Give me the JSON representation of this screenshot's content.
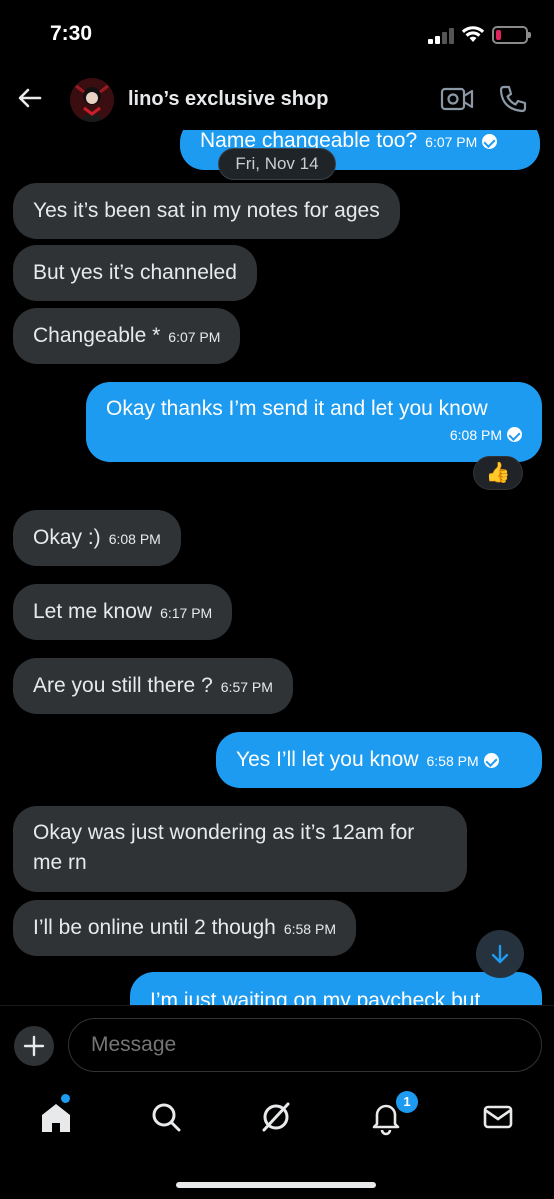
{
  "status_bar": {
    "time": "7:30"
  },
  "header": {
    "title": "lino’s exclusive shop"
  },
  "chat": {
    "date_divider": "Fri, Nov 14",
    "messages": [
      {
        "dir": "out",
        "text": "Name changeable too?",
        "time": "6:07 PM"
      },
      {
        "dir": "in",
        "text": "Yes it’s been sat in my notes for ages",
        "time": ""
      },
      {
        "dir": "in",
        "text": "But yes it’s channeled",
        "time": ""
      },
      {
        "dir": "in",
        "text": "Changeable *",
        "time": "6:07 PM"
      },
      {
        "dir": "out",
        "text": "Okay thanks I’m send it and let you know",
        "time": "6:08 PM"
      },
      {
        "dir": "in",
        "text": "Okay :)",
        "time": "6:08 PM"
      },
      {
        "dir": "in",
        "text": "Let me know",
        "time": "6:17 PM"
      },
      {
        "dir": "in",
        "text": "Are you still there ?",
        "time": "6:57 PM"
      },
      {
        "dir": "out",
        "text": "Yes I’ll let you know",
        "time": "6:58 PM"
      },
      {
        "dir": "in",
        "text": "Okay was just wondering as it’s 12am for me rn",
        "time": ""
      },
      {
        "dir": "in",
        "text": "I’ll be online until 2 though",
        "time": "6:58 PM"
      },
      {
        "dir": "out",
        "text": "I’m just waiting on my paycheck but",
        "time": ""
      }
    ],
    "reaction": "👍"
  },
  "composer": {
    "placeholder": "Message"
  },
  "tabbar": {
    "notification_count": "1"
  },
  "colors": {
    "accent": "#1d9bf0",
    "bubble_in": "#2f3336",
    "background": "#000000"
  }
}
